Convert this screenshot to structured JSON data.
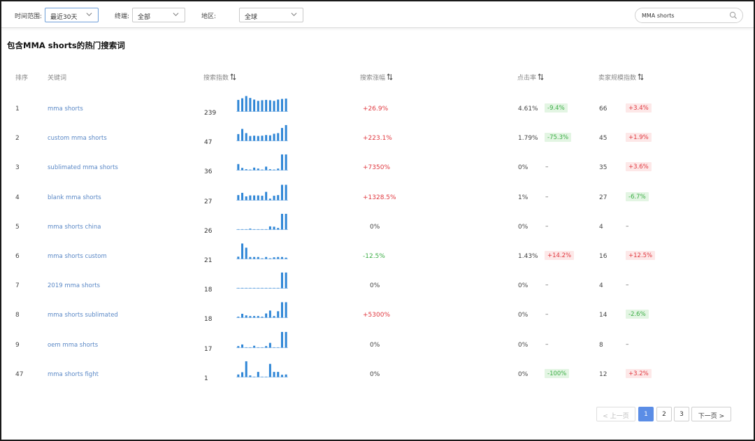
{
  "filters": {
    "time_label": "时间范围:",
    "time_value": "最近30天",
    "terminal_label": "终端:",
    "terminal_value": "全部",
    "region_label": "地区:",
    "region_value": "全球",
    "search_value": "MMA shorts"
  },
  "title": "包含MMA shorts的热门搜索词",
  "columns": {
    "rank": "排序",
    "keyword": "关键词",
    "search_index": "搜索指数",
    "search_growth": "搜索涨幅",
    "ctr": "点击率",
    "seller_scale": "卖家规模指数"
  },
  "rows": [
    {
      "rank": "1",
      "keyword": "mma shorts",
      "index": "239",
      "trend": [
        0.72,
        0.82,
        0.96,
        0.84,
        0.74,
        0.66,
        0.7,
        0.72,
        0.7,
        0.66,
        0.74,
        0.78,
        0.8
      ],
      "growth": "+26.9%",
      "growth_dir": "pos",
      "ctr": "4.61%",
      "ctr_change": "-9.4%",
      "ctr_dir": "neg",
      "scale": "66",
      "scale_change": "+3.4%",
      "scale_dir": "pos"
    },
    {
      "rank": "2",
      "keyword": "custom mma shorts",
      "index": "47",
      "trend": [
        0.42,
        0.74,
        0.48,
        0.3,
        0.32,
        0.3,
        0.32,
        0.36,
        0.34,
        0.44,
        0.48,
        0.8,
        0.98
      ],
      "growth": "+223.1%",
      "growth_dir": "pos",
      "ctr": "1.79%",
      "ctr_change": "-75.3%",
      "ctr_dir": "neg",
      "scale": "45",
      "scale_change": "+1.9%",
      "scale_dir": "pos"
    },
    {
      "rank": "3",
      "keyword": "sublimated mma shorts",
      "index": "36",
      "trend": [
        0.38,
        0.14,
        0.06,
        0.04,
        0.16,
        0.1,
        0.04,
        0.22,
        0.06,
        0.04,
        0.1,
        0.98,
        0.98
      ],
      "growth": "+7350%",
      "growth_dir": "pos",
      "ctr": "0%",
      "ctr_change": "–",
      "ctr_dir": "none",
      "scale": "35",
      "scale_change": "+3.6%",
      "scale_dir": "pos"
    },
    {
      "rank": "4",
      "keyword": "blank mma shorts",
      "index": "27",
      "trend": [
        0.32,
        0.46,
        0.24,
        0.3,
        0.3,
        0.3,
        0.28,
        0.52,
        0.1,
        0.28,
        0.32,
        0.96,
        0.96
      ],
      "growth": "+1328.5%",
      "growth_dir": "pos",
      "ctr": "1%",
      "ctr_change": "–",
      "ctr_dir": "none",
      "scale": "27",
      "scale_change": "-6.7%",
      "scale_dir": "neg"
    },
    {
      "rank": "5",
      "keyword": "mma shorts china",
      "index": "26",
      "trend": [
        0.02,
        0.02,
        0.02,
        0.06,
        0.02,
        0.02,
        0.02,
        0.02,
        0.2,
        0.18,
        0.1,
        0.98,
        0.98
      ],
      "growth": "0%",
      "growth_dir": "zero",
      "ctr": "0%",
      "ctr_change": "–",
      "ctr_dir": "none",
      "scale": "4",
      "scale_change": "–",
      "scale_dir": "none"
    },
    {
      "rank": "6",
      "keyword": "mma shorts custom",
      "index": "21",
      "trend": [
        0.14,
        0.96,
        0.7,
        0.12,
        0.12,
        0.12,
        0.04,
        0.12,
        0.04,
        0.1,
        0.12,
        0.12,
        0.08
      ],
      "growth": "-12.5%",
      "growth_dir": "neg",
      "ctr": "1.43%",
      "ctr_change": "+14.2%",
      "ctr_dir": "pos",
      "scale": "16",
      "scale_change": "+12.5%",
      "scale_dir": "pos"
    },
    {
      "rank": "7",
      "keyword": "2019 mma shorts",
      "index": "18",
      "trend": [
        0.02,
        0.02,
        0.02,
        0.02,
        0.02,
        0.02,
        0.02,
        0.02,
        0.02,
        0.02,
        0.02,
        0.98,
        0.98
      ],
      "growth": "0%",
      "growth_dir": "zero",
      "ctr": "0%",
      "ctr_change": "–",
      "ctr_dir": "none",
      "scale": "4",
      "scale_change": "–",
      "scale_dir": "none"
    },
    {
      "rank": "8",
      "keyword": "mma shorts sublimated",
      "index": "18",
      "trend": [
        0.06,
        0.24,
        0.14,
        0.1,
        0.1,
        0.1,
        0.06,
        0.26,
        0.44,
        0.1,
        0.4,
        0.96,
        0.96
      ],
      "growth": "+5300%",
      "growth_dir": "pos",
      "ctr": "0%",
      "ctr_change": "–",
      "ctr_dir": "none",
      "scale": "14",
      "scale_change": "-2.6%",
      "scale_dir": "neg"
    },
    {
      "rank": "9",
      "keyword": "oem mma shorts",
      "index": "17",
      "trend": [
        0.1,
        0.2,
        0.02,
        0.02,
        0.12,
        0.02,
        0.02,
        0.1,
        0.3,
        0.02,
        0.02,
        0.98,
        0.98
      ],
      "growth": "0%",
      "growth_dir": "zero",
      "ctr": "0%",
      "ctr_change": "–",
      "ctr_dir": "none",
      "scale": "8",
      "scale_change": "–",
      "scale_dir": "none"
    },
    {
      "rank": "47",
      "keyword": "mma shorts fight",
      "index": "1",
      "trend": [
        0.16,
        0.3,
        0.98,
        0.1,
        0.02,
        0.32,
        0.02,
        0.02,
        0.82,
        0.32,
        0.32,
        0.14,
        0.16
      ],
      "growth": "0%",
      "growth_dir": "zero",
      "ctr": "0%",
      "ctr_change": "-100%",
      "ctr_dir": "neg",
      "scale": "12",
      "scale_change": "+3.2%",
      "scale_dir": "pos"
    }
  ],
  "pagination": {
    "prev": "上一页",
    "pages": [
      "1",
      "2",
      "3"
    ],
    "current": "1",
    "next": "下一页"
  },
  "colors": {
    "accent": "#5b8de6",
    "bar": "#2f86d6",
    "positive": "#e0383f",
    "negative": "#3cae46",
    "link": "#5a88c6"
  }
}
